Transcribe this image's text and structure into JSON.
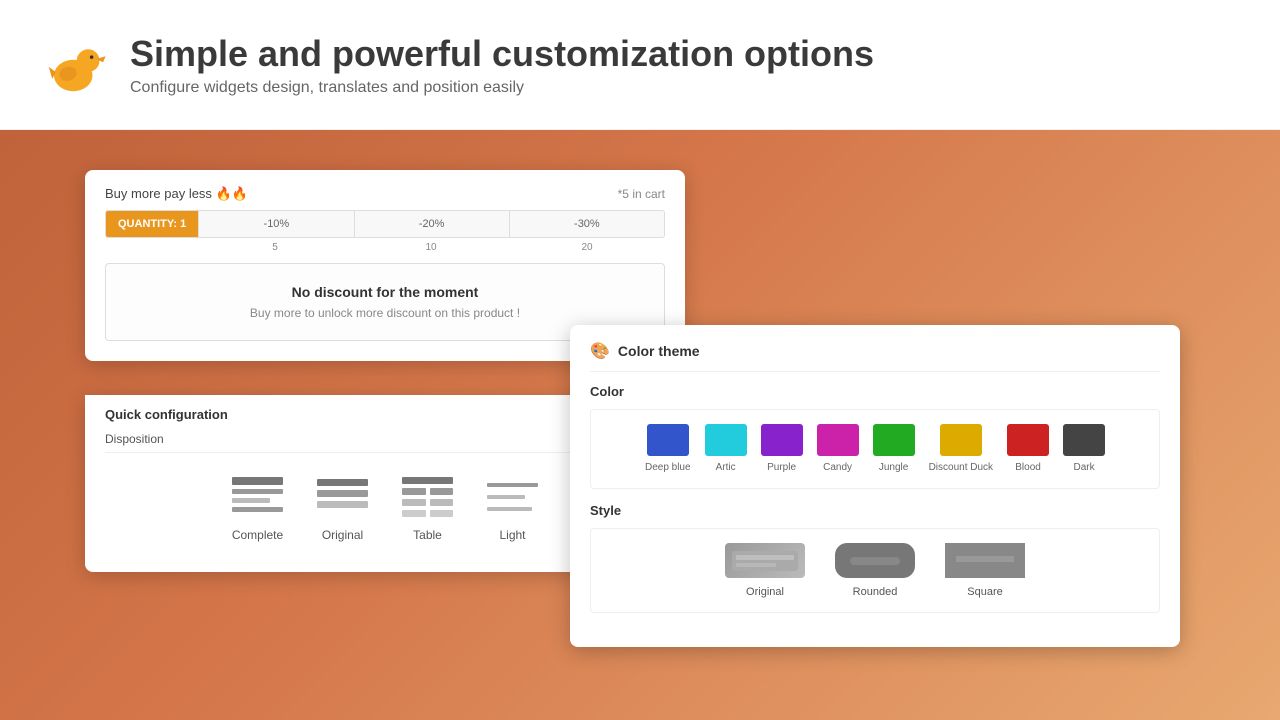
{
  "header": {
    "title": "Simple and powerful customization options",
    "subtitle": "Configure widgets design, translates and position easily"
  },
  "widget": {
    "buy_more_label": "Buy more pay less 🔥🔥",
    "cart_count": "*5 in cart",
    "quantity_active": "QUANTITY: 1",
    "segments": [
      "-10%",
      "-20%",
      "-30%"
    ],
    "numbers": [
      "5",
      "10",
      "20"
    ],
    "no_discount_title": "No discount for the moment",
    "no_discount_sub": "Buy more to unlock more discount on this product !"
  },
  "quick_config": {
    "title": "Quick configuration",
    "disposition_label": "Disposition",
    "options": [
      {
        "id": "complete",
        "label": "Complete"
      },
      {
        "id": "original",
        "label": "Original"
      },
      {
        "id": "table",
        "label": "Table"
      },
      {
        "id": "light",
        "label": "Light"
      }
    ]
  },
  "color_theme": {
    "title": "Color theme",
    "color_label": "Color",
    "style_label": "Style",
    "colors": [
      {
        "name": "Deep blue",
        "hex": "#3355cc"
      },
      {
        "name": "Artic",
        "hex": "#22ccdd"
      },
      {
        "name": "Purple",
        "hex": "#8822cc"
      },
      {
        "name": "Candy",
        "hex": "#cc22aa"
      },
      {
        "name": "Jungle",
        "hex": "#22aa22"
      },
      {
        "name": "Discount Duck",
        "hex": "#ddaa00"
      },
      {
        "name": "Blood",
        "hex": "#cc2222"
      },
      {
        "name": "Dark",
        "hex": "#444444"
      }
    ],
    "styles": [
      {
        "name": "Original"
      },
      {
        "name": "Rounded"
      },
      {
        "name": "Square"
      }
    ]
  }
}
